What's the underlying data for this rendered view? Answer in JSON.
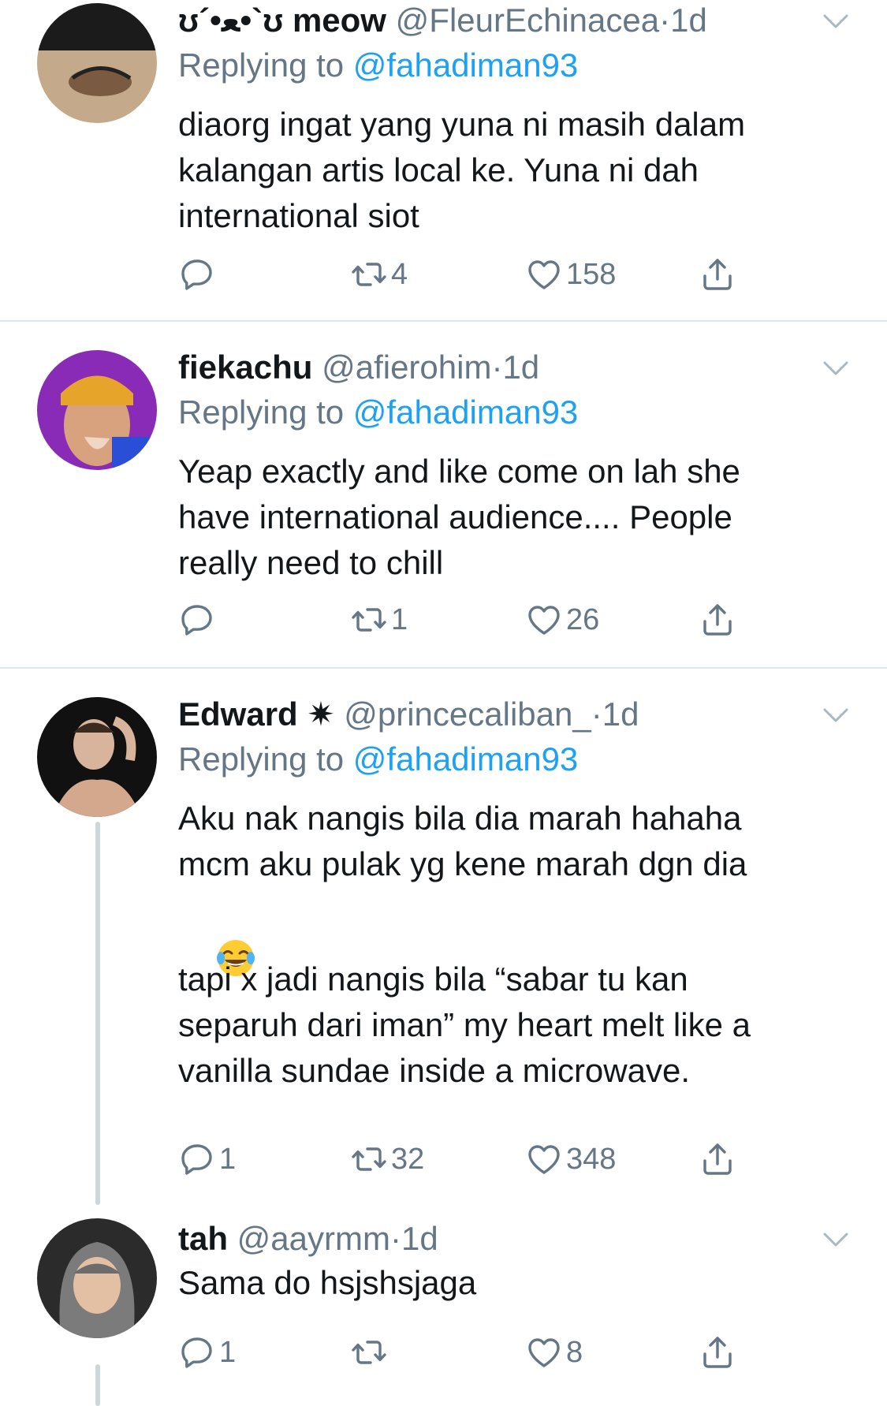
{
  "colors": {
    "link": "#1da1f2",
    "muted": "#657786",
    "text": "#14171a",
    "divider": "#e1e8ed"
  },
  "tweets": [
    {
      "name": "ʊ´•ﻌ•`ʊ meow",
      "handle": "@FleurEchinacea",
      "dot": "·",
      "time": "1d",
      "replying_prefix": "Replying to",
      "replying_to": "@fahadiman93",
      "text": "diaorg ingat yang yuna ni masih dalam\nkalangan artis local ke. Yuna ni dah\ninternational siot",
      "replies": "",
      "retweets": "4",
      "likes": "158"
    },
    {
      "name": "fiekachu",
      "handle": "@afierohim",
      "dot": "·",
      "time": "1d",
      "replying_prefix": "Replying to",
      "replying_to": "@fahadiman93",
      "text": "Yeap exactly and like come on lah she\nhave international audience.... People\nreally need to chill",
      "replies": "",
      "retweets": "1",
      "likes": "26"
    },
    {
      "name": "Edward ✷",
      "handle": "@princecaliban_",
      "dot": "·",
      "time": "1d",
      "replying_prefix": "Replying to",
      "replying_to": "@fahadiman93",
      "text_1": "Aku nak nangis bila dia marah hahaha\nmcm aku pulak yg kene marah dgn dia",
      "emoji": "face-with-tears-of-joy",
      "text_2": "tapi x jadi nangis bila “sabar tu kan\nseparuh dari iman” my heart melt like a\nvanilla sundae inside a microwave.",
      "replies": "1",
      "retweets": "32",
      "likes": "348"
    },
    {
      "name": "tah",
      "handle": "@aayrmm",
      "dot": "·",
      "time": "1d",
      "text": "Sama do hsjshsjaga",
      "replies": "1",
      "retweets": "",
      "likes": "8"
    }
  ],
  "icons": {
    "reply": "reply-icon",
    "retweet": "retweet-icon",
    "like": "heart-icon",
    "share": "share-icon",
    "more": "chevron-down-icon"
  }
}
